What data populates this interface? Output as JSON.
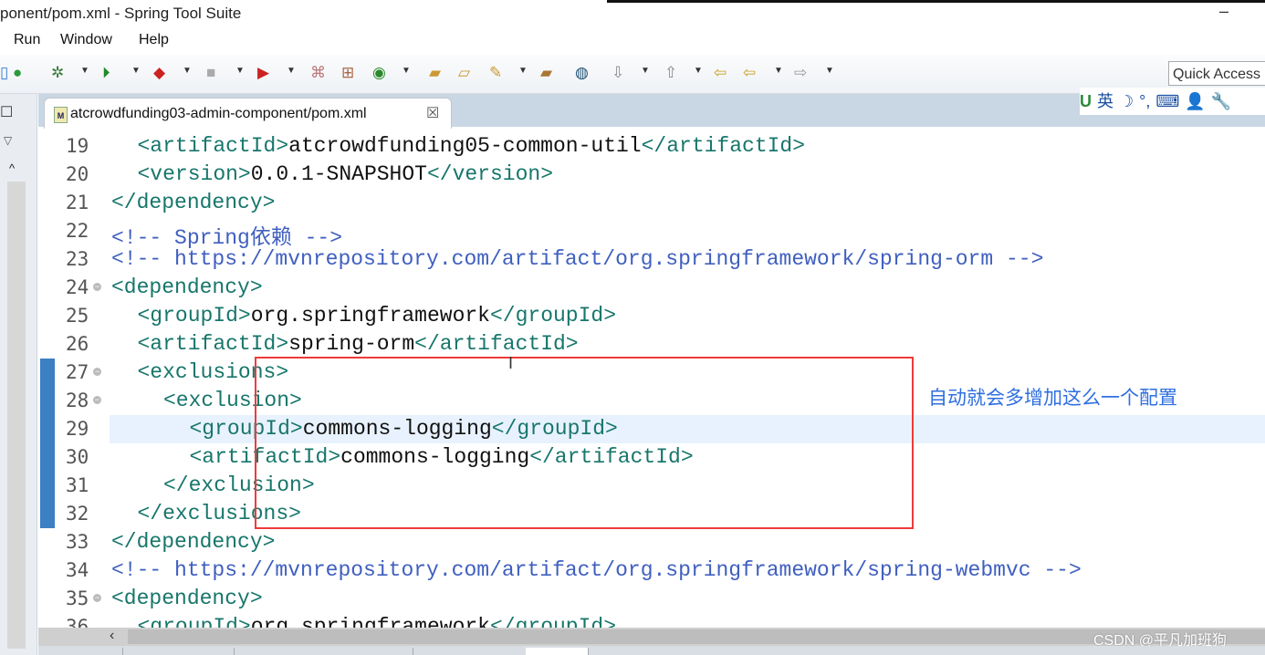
{
  "window": {
    "title": "ponent/pom.xml - Spring Tool Suite",
    "minimize_glyph": "–"
  },
  "menu": {
    "items": [
      "Run",
      "Window",
      "Help"
    ]
  },
  "toolbar": {
    "icons": [
      "perspective-icon",
      "new-error-icon",
      "debug-icon",
      "run-icon",
      "run-config-icon",
      "stop-icon",
      "launch-icon",
      "aspectj-icon",
      "new-package-icon",
      "new-class-icon",
      "open-project-icon",
      "open-folder-icon",
      "pen-icon",
      "folder-icon",
      "globe-icon",
      "next-annotation-icon",
      "prev-annotation-icon",
      "last-edit-icon",
      "back-icon",
      "forward-icon"
    ],
    "quick_access_placeholder": "Quick Access"
  },
  "ime": {
    "items": [
      "U",
      "英",
      "☽",
      "°,",
      "⌨",
      "👤",
      "🔧"
    ]
  },
  "editor_tab": {
    "label": "atcrowdfunding03-admin-component/pom.xml",
    "close_glyph": "☒",
    "file_badge": "M"
  },
  "editor": {
    "current_line": 29,
    "lines": [
      {
        "n": "19",
        "indent": 3,
        "segs": [
          [
            "tag",
            "<artifactId>"
          ],
          [
            "txt",
            "atcrowdfunding05-common-util"
          ],
          [
            "tag",
            "</artifactId>"
          ]
        ]
      },
      {
        "n": "20",
        "indent": 3,
        "segs": [
          [
            "tag",
            "<version>"
          ],
          [
            "txt",
            "0.0.1-SNAPSHOT"
          ],
          [
            "tag",
            "</version>"
          ]
        ]
      },
      {
        "n": "21",
        "indent": 2,
        "segs": [
          [
            "tag",
            "</dependency>"
          ]
        ]
      },
      {
        "n": "22",
        "indent": 2,
        "segs": [
          [
            "cmt",
            "<!-- Spring依赖 -->"
          ]
        ]
      },
      {
        "n": "23",
        "indent": 2,
        "segs": [
          [
            "cmt",
            "<!-- https://mvnrepository.com/artifact/org.springframework/spring-orm -->"
          ]
        ]
      },
      {
        "n": "24",
        "indent": 2,
        "fold": true,
        "segs": [
          [
            "tag",
            "<dependency>"
          ]
        ]
      },
      {
        "n": "25",
        "indent": 3,
        "segs": [
          [
            "tag",
            "<groupId>"
          ],
          [
            "txt",
            "org.springframework"
          ],
          [
            "tag",
            "</groupId>"
          ]
        ]
      },
      {
        "n": "26",
        "indent": 3,
        "segs": [
          [
            "tag",
            "<artifactId>"
          ],
          [
            "txt",
            "spring-orm"
          ],
          [
            "tag",
            "</artifactId>"
          ]
        ]
      },
      {
        "n": "27",
        "indent": 3,
        "fold": true,
        "changed": true,
        "segs": [
          [
            "tag",
            "<exclusions>"
          ]
        ]
      },
      {
        "n": "28",
        "indent": 4,
        "fold": true,
        "changed": true,
        "segs": [
          [
            "tag",
            "<exclusion>"
          ]
        ]
      },
      {
        "n": "29",
        "indent": 5,
        "changed": true,
        "segs": [
          [
            "tag",
            "<groupId>"
          ],
          [
            "txt",
            "commons-logging"
          ],
          [
            "tag",
            "</groupId>"
          ]
        ]
      },
      {
        "n": "30",
        "indent": 5,
        "changed": true,
        "segs": [
          [
            "tag",
            "<artifactId>"
          ],
          [
            "txt",
            "commons-logging"
          ],
          [
            "tag",
            "</artifactId>"
          ]
        ]
      },
      {
        "n": "31",
        "indent": 4,
        "changed": true,
        "segs": [
          [
            "tag",
            "</exclusion>"
          ]
        ]
      },
      {
        "n": "32",
        "indent": 3,
        "changed": true,
        "segs": [
          [
            "tag",
            "</exclusions>"
          ]
        ]
      },
      {
        "n": "33",
        "indent": 2,
        "segs": [
          [
            "tag",
            "</dependency>"
          ]
        ]
      },
      {
        "n": "34",
        "indent": 2,
        "segs": [
          [
            "cmt",
            "<!-- https://mvnrepository.com/artifact/org.springframework/spring-webmvc -->"
          ]
        ]
      },
      {
        "n": "35",
        "indent": 2,
        "fold": true,
        "segs": [
          [
            "tag",
            "<dependency>"
          ]
        ]
      },
      {
        "n": "36",
        "indent": 3,
        "segs": [
          [
            "tag",
            "<groupId>"
          ],
          [
            "txt",
            "org.springframework"
          ],
          [
            "tag",
            "</groupId>"
          ]
        ]
      }
    ]
  },
  "annotation": {
    "text": "自动就会多增加这么一个配置",
    "color": "#2f6fe0",
    "box_color": "#f03a3a"
  },
  "watermark": "CSDN @平凡加班狗",
  "colors": {
    "tag": "#17766b",
    "text": "#111111",
    "comment": "#3f5fbf",
    "current_line": "#e8f2fe",
    "change_marker": "#3c7fc3"
  }
}
